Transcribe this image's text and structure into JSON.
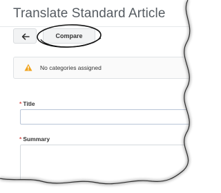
{
  "page": {
    "title": "Translate Standard Article"
  },
  "toolbar": {
    "back_icon": "arrow-left-icon",
    "compare_label": "Compare"
  },
  "alert": {
    "icon": "warning-triangle-icon",
    "text": "No categories assigned",
    "icon_color": "#f0a31c"
  },
  "form": {
    "title_label": "Title",
    "title_value": "",
    "summary_label": "Summary",
    "summary_value": "",
    "required_marker": "*",
    "required_color": "#d9534f"
  },
  "annotation": {
    "ellipse_color": "#111111"
  }
}
